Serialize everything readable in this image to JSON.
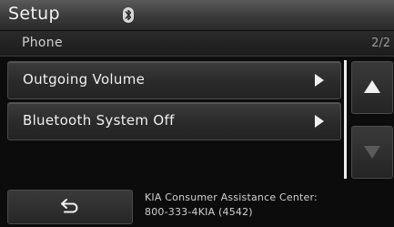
{
  "header": {
    "title": "Setup",
    "status_icon": "bluetooth-icon"
  },
  "subheader": {
    "title": "Phone",
    "page_indicator": "2/2"
  },
  "menu": {
    "items": [
      {
        "label": "Outgoing Volume",
        "icon": "arrow-right-icon"
      },
      {
        "label": "Bluetooth System Off",
        "icon": "arrow-right-icon"
      }
    ]
  },
  "scroll": {
    "up_icon": "arrow-up-icon",
    "down_icon": "arrow-down-icon",
    "down_enabled": false
  },
  "footer": {
    "back_icon": "back-icon",
    "info_line1": "KIA Consumer Assistance Center:",
    "info_line2": "800-333-4KIA (4542)"
  }
}
